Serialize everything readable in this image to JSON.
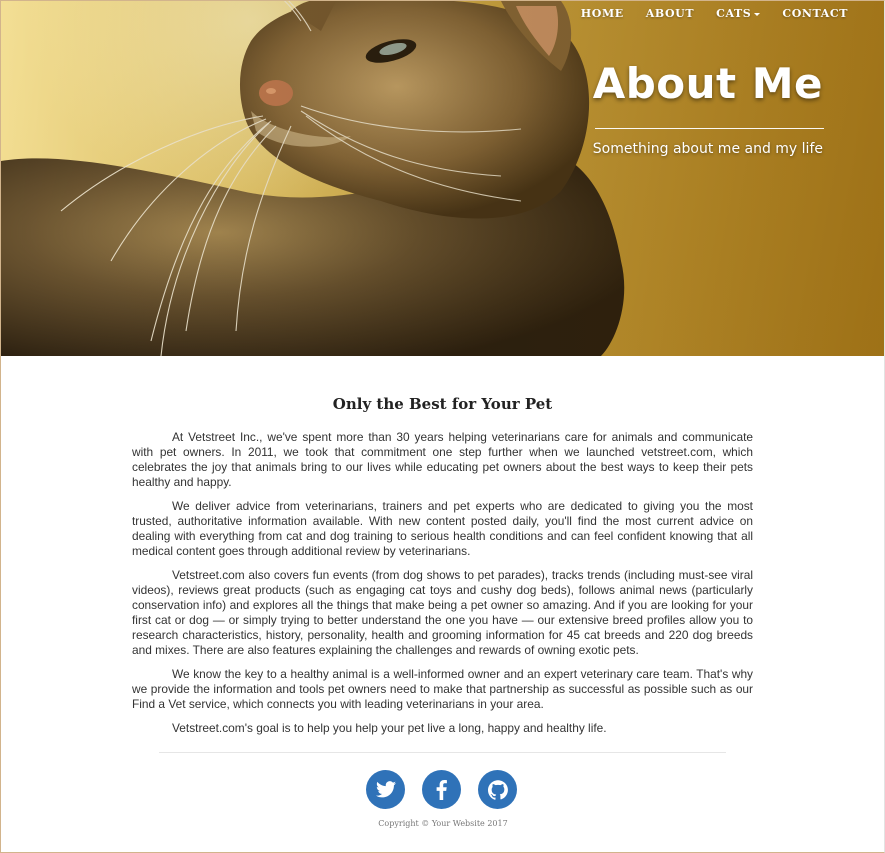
{
  "nav": {
    "items": [
      {
        "label": "HOME"
      },
      {
        "label": "ABOUT"
      },
      {
        "label": "CATS",
        "has_dropdown": true
      },
      {
        "label": "CONTACT"
      }
    ]
  },
  "hero": {
    "title": "About Me",
    "subtitle": "Something about me and my life"
  },
  "main": {
    "heading": "Only the Best for Your Pet",
    "paragraphs": [
      "At Vetstreet Inc., we've spent more than 30 years helping veterinarians care for animals and communicate with pet owners. In 2011, we took that commitment one step further when we launched vetstreet.com, which celebrates the joy that animals bring to our lives while educating pet owners about the best ways to keep their pets healthy and happy.",
      "We deliver advice from veterinarians, trainers and pet experts who are dedicated to giving you the most trusted, authoritative information available. With new content posted daily, you'll find the most current advice on dealing with everything from cat and dog training to serious health conditions and can feel confident knowing that all medical content goes through additional review by veterinarians.",
      "Vetstreet.com also covers fun events (from dog shows to pet parades), tracks trends (including must-see viral videos), reviews great products (such as engaging cat toys and cushy dog beds), follows animal news (particularly conservation info) and explores all the things that make being a pet owner so amazing. And if you are looking for your first cat or dog — or simply trying to better understand the one you have — our extensive breed profiles allow you to research characteristics, history, personality, health and grooming information for 45 cat breeds and 220 dog breeds and mixes. There are also features explaining the challenges and rewards of owning exotic pets.",
      "We know the key to a healthy animal is a well-informed owner and an expert veterinary care team. That's why we provide the information and tools pet owners need to make that partnership as successful as possible such as our Find a Vet service, which connects you with leading veterinarians in your area.",
      "Vetstreet.com's goal is to help you help your pet live a long, happy and healthy life."
    ]
  },
  "footer": {
    "social": [
      {
        "icon": "twitter-icon"
      },
      {
        "icon": "facebook-icon"
      },
      {
        "icon": "github-icon"
      }
    ],
    "copyright": "Copyright © Your Website 2017"
  },
  "colors": {
    "social_button": "#2f72b8",
    "hero_gold": "#d2a83f"
  }
}
